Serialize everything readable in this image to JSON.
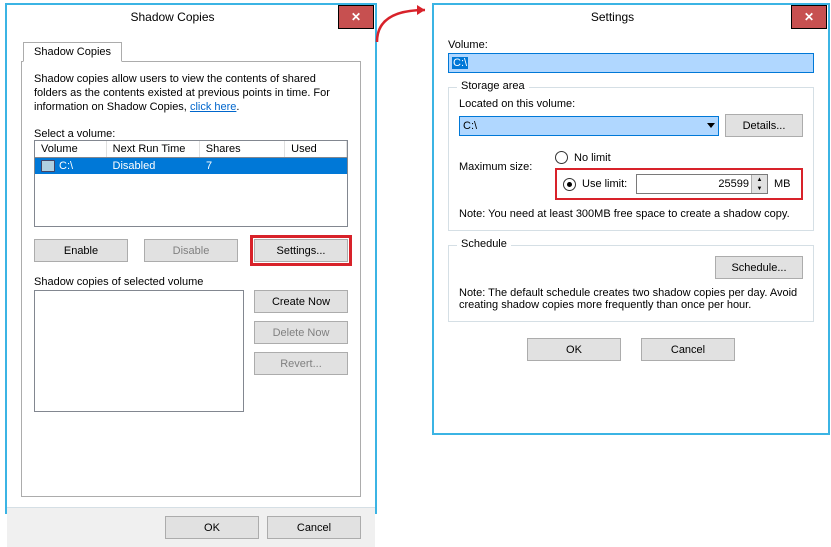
{
  "dlg1": {
    "title": "Shadow Copies",
    "tab": "Shadow Copies",
    "desc1": "Shadow copies allow users to view the contents of shared folders as the contents existed at previous points in time. For information on Shadow Copies, ",
    "linkText": "click here",
    "desc2": ".",
    "selectLabel": "Select a volume:",
    "headers": {
      "vol": "Volume",
      "next": "Next Run Time",
      "shares": "Shares",
      "used": "Used"
    },
    "row": {
      "vol": "C:\\",
      "next": "Disabled",
      "shares": "7",
      "used": ""
    },
    "enableBtn": "Enable",
    "disableBtn": "Disable",
    "settingsBtn": "Settings...",
    "copiesLabel": "Shadow copies of selected volume",
    "createBtn": "Create Now",
    "deleteBtn": "Delete Now",
    "revertBtn": "Revert...",
    "okBtn": "OK",
    "cancelBtn": "Cancel"
  },
  "dlg2": {
    "title": "Settings",
    "volLabel": "Volume:",
    "volValue": "C:\\",
    "storageLegend": "Storage area",
    "locatedLabel": "Located on this volume:",
    "locatedValue": "C:\\",
    "detailsBtn": "Details...",
    "maxLabel": "Maximum size:",
    "noLimitLabel": "No limit",
    "useLimitLabel": "Use limit:",
    "limitValue": "25599",
    "mb": "MB",
    "storageNote": "Note: You need at least 300MB free space to create a shadow copy.",
    "schedLegend": "Schedule",
    "schedBtn": "Schedule...",
    "schedNote": "Note: The default schedule creates two shadow copies per day. Avoid creating shadow copies more frequently than once per hour.",
    "okBtn": "OK",
    "cancelBtn": "Cancel"
  }
}
